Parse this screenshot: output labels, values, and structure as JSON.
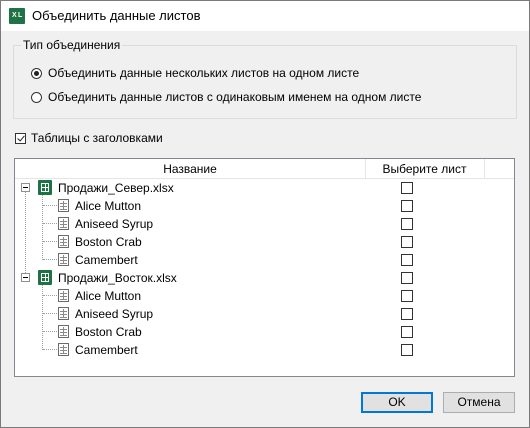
{
  "window": {
    "title": "Объединить данные листов",
    "app_icon_text": "X L"
  },
  "merge_type": {
    "legend": "Тип объединения",
    "options": [
      {
        "label": "Объединить данные нескольких листов на одном листе",
        "checked": true
      },
      {
        "label": "Объединить данные листов с одинаковым именем на одном листе",
        "checked": false
      }
    ]
  },
  "headers_checkbox": {
    "label": "Таблицы с заголовками",
    "checked": true
  },
  "tree": {
    "columns": {
      "name": "Название",
      "select": "Выберите лист"
    },
    "workbooks": [
      {
        "name": "Продажи_Север.xlsx",
        "sheets": [
          "Alice Mutton",
          "Aniseed Syrup",
          "Boston Crab",
          "Camembert"
        ]
      },
      {
        "name": "Продажи_Восток.xlsx",
        "sheets": [
          "Alice Mutton",
          "Aniseed Syrup",
          "Boston Crab",
          "Camembert"
        ]
      }
    ]
  },
  "buttons": {
    "ok": "OK",
    "cancel": "Отмена"
  }
}
